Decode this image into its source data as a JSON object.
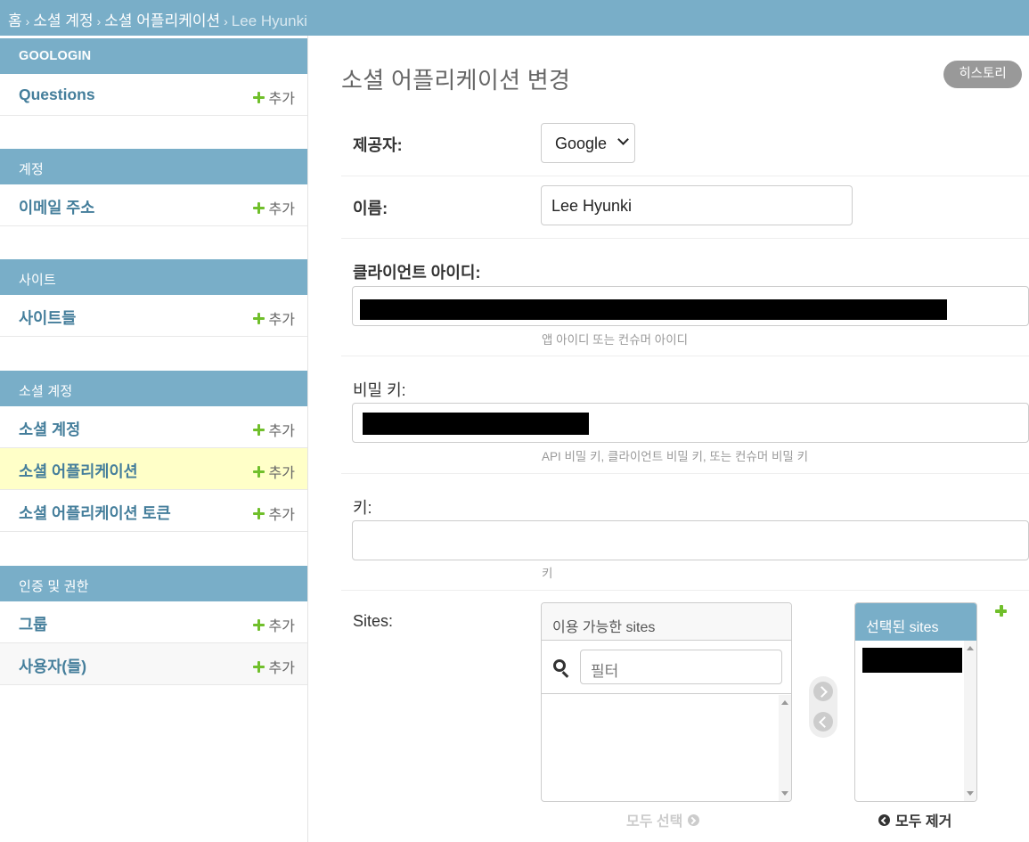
{
  "breadcrumb": {
    "home": "홈",
    "app": "소셜 계정",
    "model": "소셜 어플리케이션",
    "current": "Lee Hyunki"
  },
  "sidebar": {
    "add_label": "추가",
    "modules": [
      {
        "caption": "GOOLOGIN",
        "models": [
          {
            "name": "Questions"
          }
        ]
      },
      {
        "caption": "계정",
        "models": [
          {
            "name": "이메일 주소"
          }
        ]
      },
      {
        "caption": "사이트",
        "models": [
          {
            "name": "사이트들"
          }
        ]
      },
      {
        "caption": "소셜 계정",
        "models": [
          {
            "name": "소셜 계정"
          },
          {
            "name": "소셜 어플리케이션",
            "selected": true
          },
          {
            "name": "소셜 어플리케이션 토큰"
          }
        ]
      },
      {
        "caption": "인증 및 권한",
        "models": [
          {
            "name": "그룹"
          },
          {
            "name": "사용자(들)"
          }
        ]
      }
    ]
  },
  "main": {
    "title": "소셜 어플리케이션 변경",
    "history_button": "히스토리",
    "fields": {
      "provider": {
        "label": "제공자:",
        "value": "Google"
      },
      "name": {
        "label": "이름:",
        "value": "Lee Hyunki"
      },
      "client_id": {
        "label": "클라이언트 아이디:",
        "help": "앱 아이디 또는 컨슈머 아이디"
      },
      "secret": {
        "label": "비밀 키:",
        "help": "API 비밀 키, 클라이언트 비밀 키, 또는 컨슈머 비밀 키"
      },
      "key": {
        "label": "키:",
        "value": "",
        "help": "키"
      },
      "sites": {
        "label": "Sites:",
        "available_caption": "이용 가능한 sites",
        "filter_placeholder": "필터",
        "chosen_caption": "선택된 sites",
        "choose_all": "모두 선택",
        "remove_all": "모두 제거"
      }
    }
  },
  "colors": {
    "header": "#79aec8",
    "link": "#447e9b",
    "selected_row": "#ffffc8",
    "add_icon": "#70bf2b"
  }
}
